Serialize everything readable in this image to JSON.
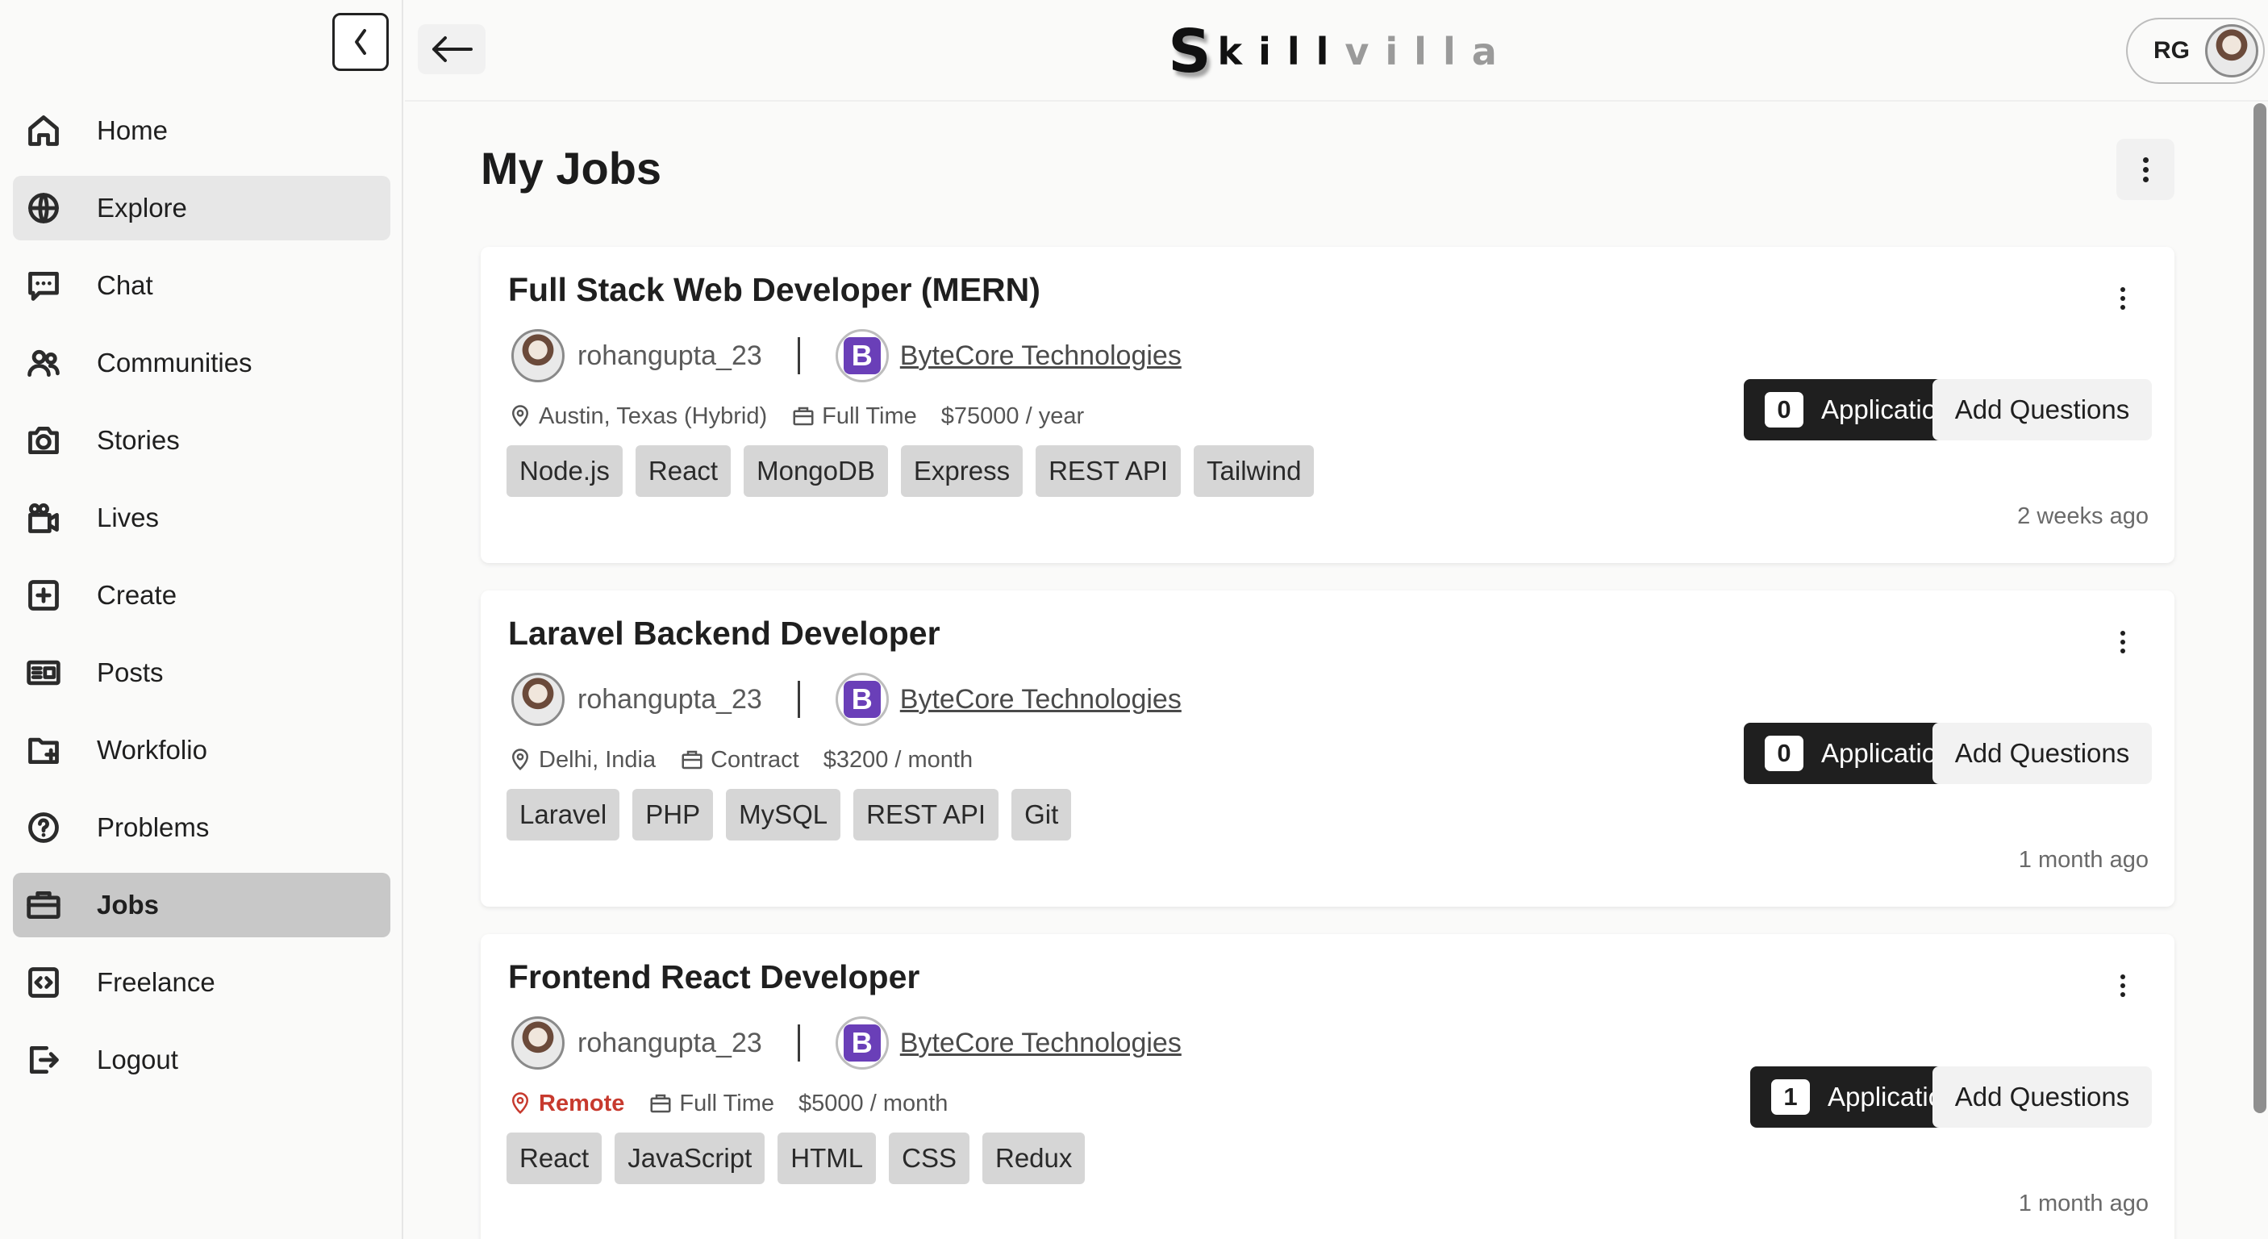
{
  "app": {
    "logo_first": "S",
    "logo_dark": "kill",
    "logo_light": "villa",
    "user_initials": "RG"
  },
  "sidebar": {
    "items": [
      {
        "label": "Home",
        "icon": "home-icon"
      },
      {
        "label": "Explore",
        "icon": "globe-icon",
        "state": "hover"
      },
      {
        "label": "Chat",
        "icon": "chat-icon"
      },
      {
        "label": "Communities",
        "icon": "users-icon"
      },
      {
        "label": "Stories",
        "icon": "camera-icon"
      },
      {
        "label": "Lives",
        "icon": "live-video-icon"
      },
      {
        "label": "Create",
        "icon": "plus-square-icon"
      },
      {
        "label": "Posts",
        "icon": "posts-icon"
      },
      {
        "label": "Workfolio",
        "icon": "folder-plus-icon"
      },
      {
        "label": "Problems",
        "icon": "question-circle-icon"
      },
      {
        "label": "Jobs",
        "icon": "briefcase-icon",
        "state": "active"
      },
      {
        "label": "Freelance",
        "icon": "code-square-icon"
      },
      {
        "label": "Logout",
        "icon": "logout-icon"
      }
    ]
  },
  "main": {
    "title": "My Jobs"
  },
  "jobs": [
    {
      "title": "Full Stack Web Developer (MERN)",
      "poster": "rohangupta_23",
      "company": "ByteCore Technologies",
      "company_initial": "B",
      "location": "Austin, Texas (Hybrid)",
      "type": "Full Time",
      "salary": "$75000 / year",
      "tags": [
        "Node.js",
        "React",
        "MongoDB",
        "Express",
        "REST API",
        "Tailwind"
      ],
      "applications": "0",
      "applications_label": "Applications",
      "add_questions": "Add Questions",
      "posted": "2 weeks ago"
    },
    {
      "title": "Laravel Backend Developer",
      "poster": "rohangupta_23",
      "company": "ByteCore Technologies",
      "company_initial": "B",
      "location": "Delhi, India",
      "type": "Contract",
      "salary": "$3200 / month",
      "tags": [
        "Laravel",
        "PHP",
        "MySQL",
        "REST API",
        "Git"
      ],
      "applications": "0",
      "applications_label": "Applications",
      "add_questions": "Add Questions",
      "posted": "1 month ago"
    },
    {
      "title": "Frontend React Developer",
      "poster": "rohangupta_23",
      "company": "ByteCore Technologies",
      "company_initial": "B",
      "location": "Remote",
      "location_is_remote": true,
      "type": "Full Time",
      "salary": "$5000 / month",
      "tags": [
        "React",
        "JavaScript",
        "HTML",
        "CSS",
        "Redux"
      ],
      "applications": "1",
      "applications_label": "Applications",
      "add_questions": "Add Questions",
      "posted": "1 month ago"
    }
  ],
  "colors": {
    "accent_dark": "#1f1f1f",
    "company_logo": "#6a3fb8",
    "remote": "#c73a2e",
    "nav_active": "#c8c8c8"
  }
}
